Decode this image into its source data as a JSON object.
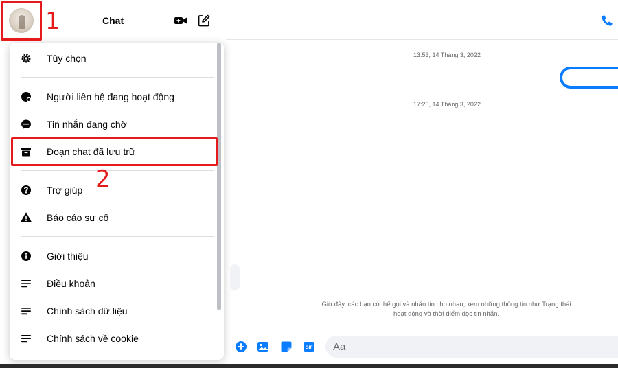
{
  "header": {
    "title": "Chat"
  },
  "menu": {
    "items": [
      {
        "label": "Tùy chọn",
        "icon": "gear-icon"
      },
      {
        "label": "Người liên hệ đang hoạt động",
        "icon": "active-contacts-icon"
      },
      {
        "label": "Tin nhắn đang chờ",
        "icon": "message-bubble-icon"
      },
      {
        "label": "Đoạn chat đã lưu trữ",
        "icon": "archive-icon"
      },
      {
        "label": "Trợ giúp",
        "icon": "help-icon"
      },
      {
        "label": "Báo cáo sự cố",
        "icon": "warning-icon"
      },
      {
        "label": "Giới thiệu",
        "icon": "info-icon"
      },
      {
        "label": "Điều khoản",
        "icon": "lines-icon"
      },
      {
        "label": "Chính sách dữ liệu",
        "icon": "lines-icon"
      },
      {
        "label": "Chính sách về cookie",
        "icon": "lines-icon"
      }
    ]
  },
  "annotations": {
    "step1": "1",
    "step2": "2"
  },
  "conversation": {
    "timestamps": [
      "13:53, 14 Tháng 3, 2022",
      "17:20, 14 Tháng 3, 2022"
    ],
    "info": "Giờ đây, các bạn có thể gọi và nhắn tin cho nhau, xem những thông tin như Trạng thái hoạt động và thời điểm đọc tin nhắn."
  },
  "composer": {
    "placeholder": "Aa",
    "gif_label": "GIF"
  },
  "colors": {
    "accent": "#0a7cff",
    "annotation": "#e51a1a"
  }
}
